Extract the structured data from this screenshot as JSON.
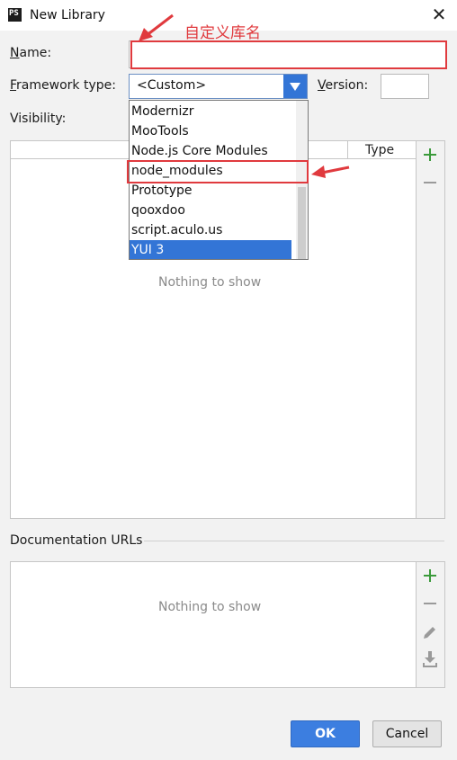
{
  "window": {
    "app_icon": "PS",
    "title": "New Library",
    "close_glyph": "✕"
  },
  "form": {
    "name_label_first": "N",
    "name_label_rest": "ame:",
    "name_value": "",
    "framework_label_first": "F",
    "framework_label_rest": "ramework type:",
    "framework_value": "<Custom>",
    "version_label_first": "V",
    "version_label_rest": "ersion:",
    "version_value": "",
    "visibility_label": "Visibility:"
  },
  "dropdown": {
    "items": [
      "Modernizr",
      "MooTools",
      "Node.js Core Modules",
      "node_modules",
      "Prototype",
      "qooxdoo",
      "script.aculo.us",
      "YUI 3"
    ],
    "selected_index": 7
  },
  "files_table": {
    "column_type": "Type",
    "empty_text": "Nothing to show"
  },
  "documentation": {
    "section_label": "Documentation URLs",
    "empty_text": "Nothing to show"
  },
  "buttons": {
    "ok_label": "OK",
    "cancel_label": "Cancel"
  },
  "annotation": {
    "name_note": "自定义库名",
    "color": "#e03a3e"
  },
  "icons": [
    "close-icon",
    "plus-icon",
    "minus-icon",
    "edit-icon",
    "download-icon",
    "dropdown-arrow-icon"
  ]
}
